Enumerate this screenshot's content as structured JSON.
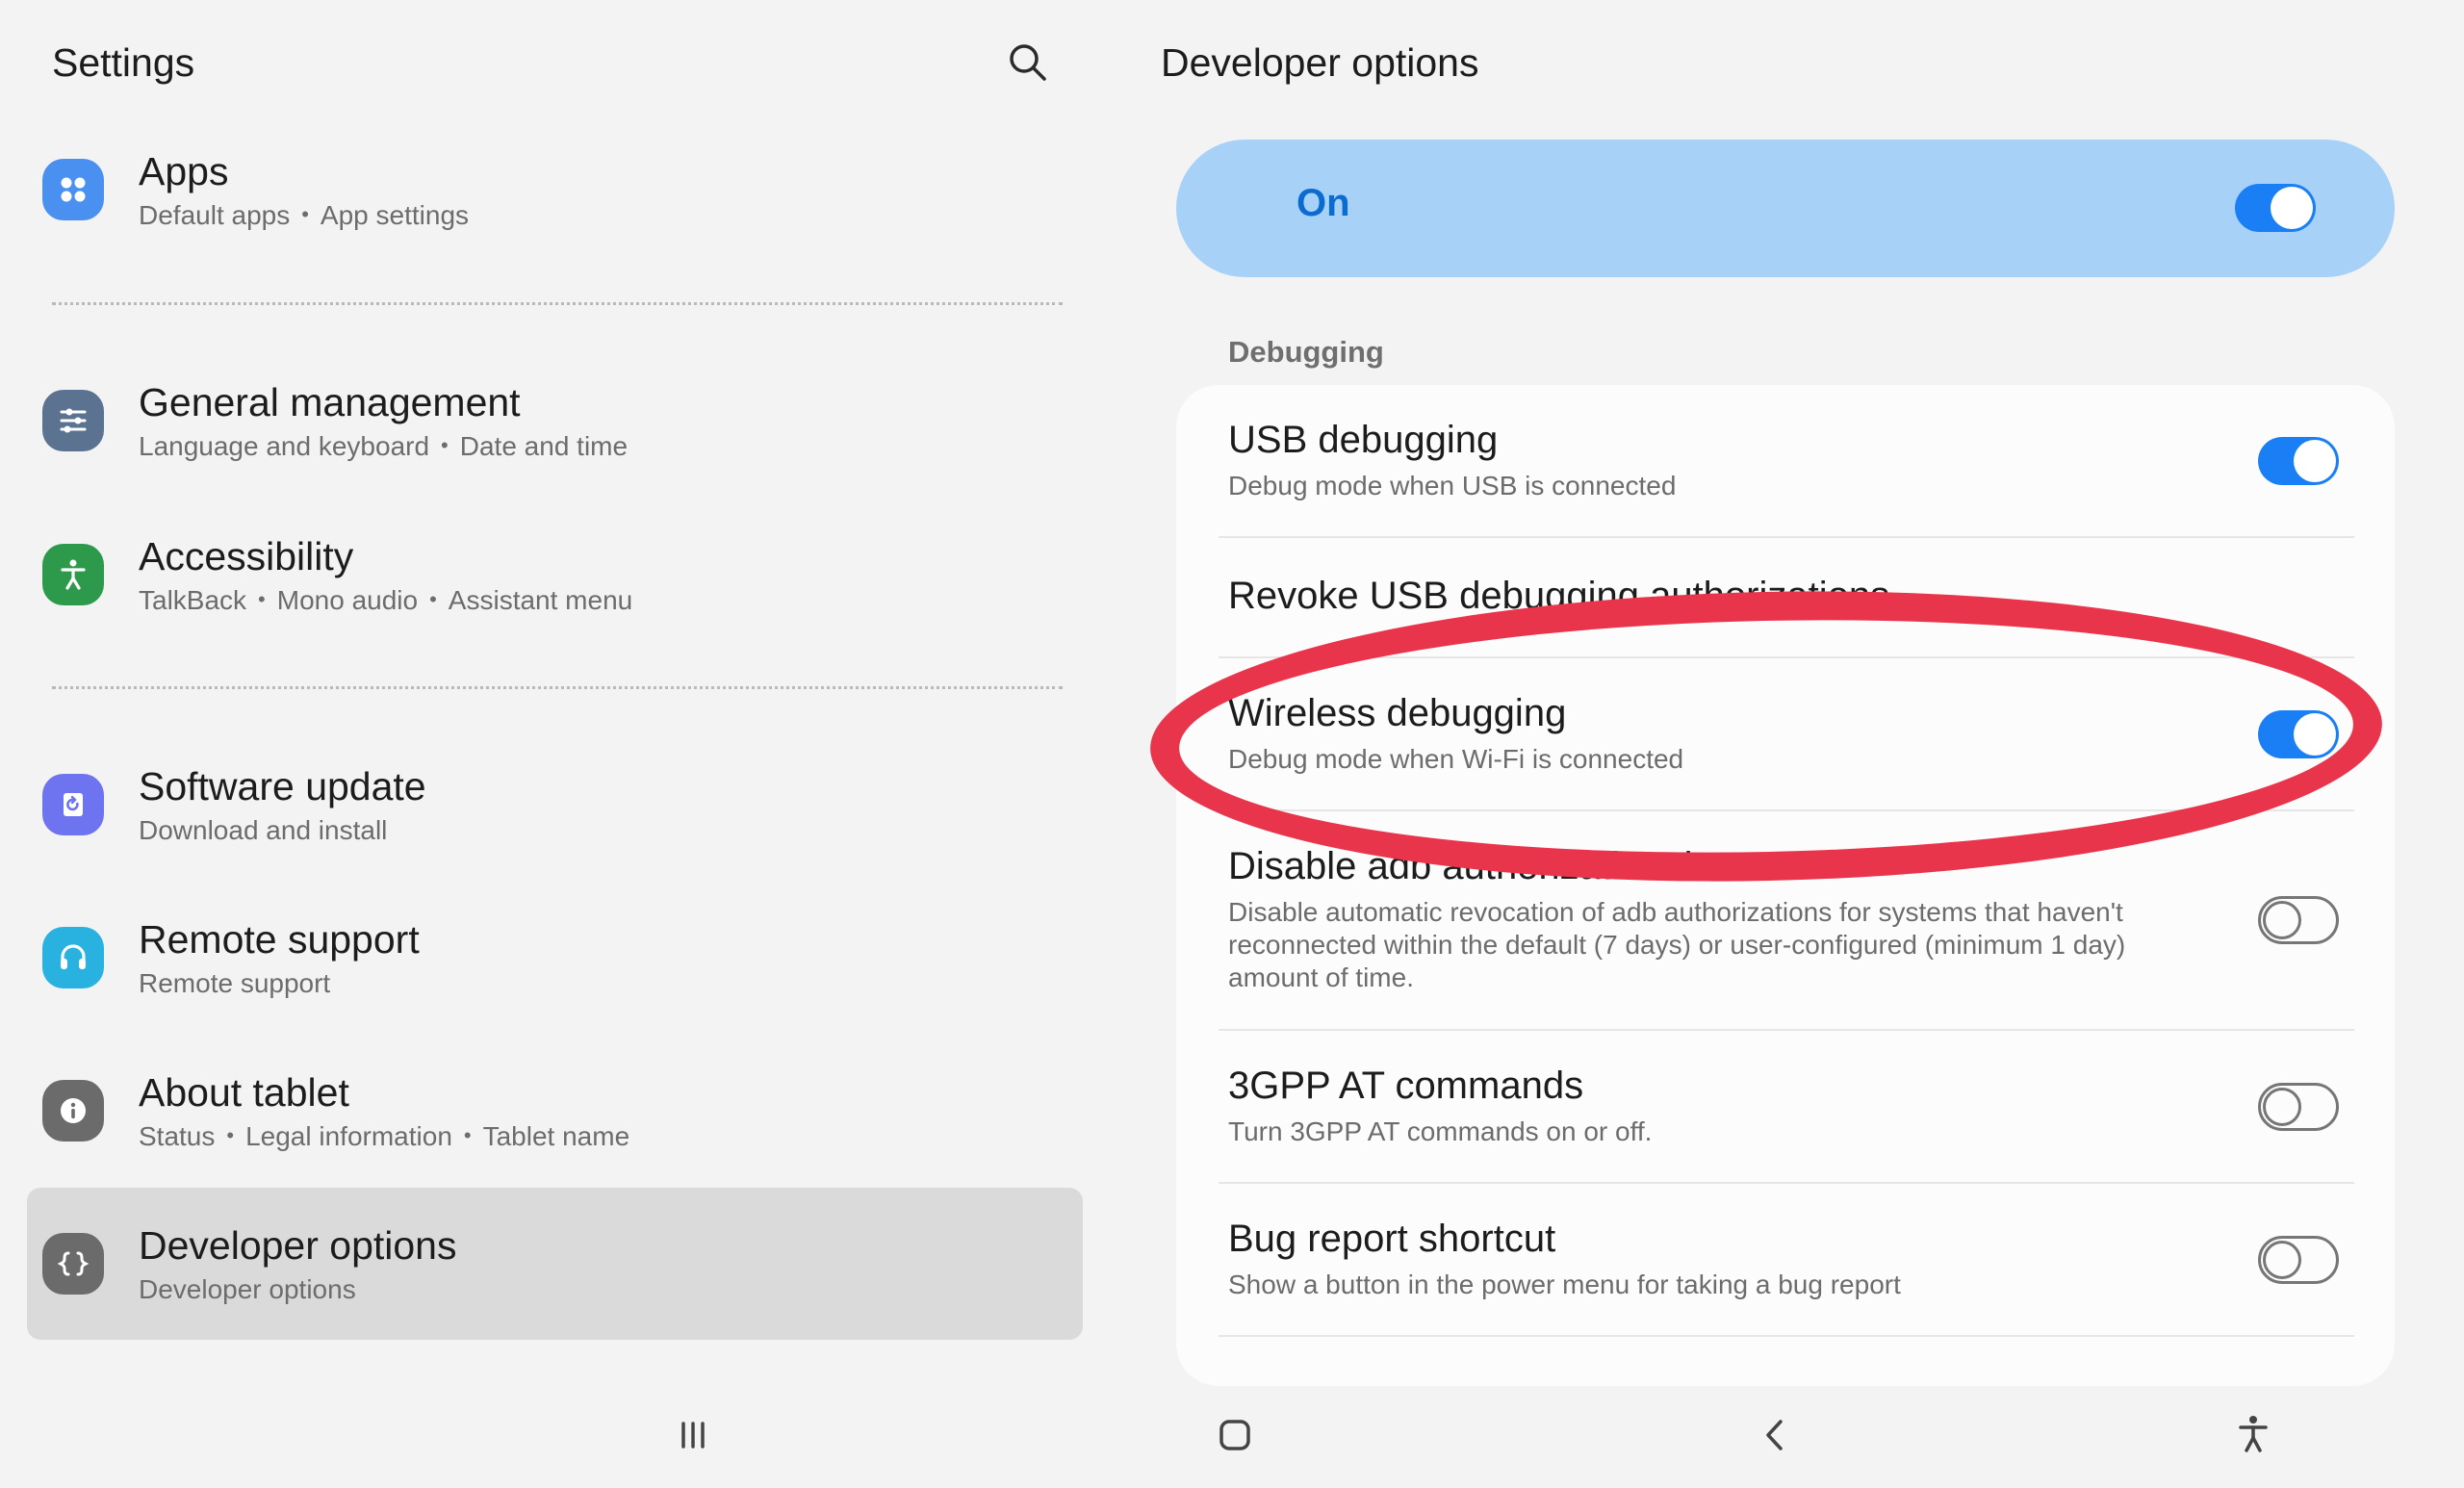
{
  "left": {
    "title": "Settings",
    "items": [
      {
        "title": "Apps",
        "sub": [
          "Default apps",
          "App settings"
        ],
        "color": "#4a90f0",
        "icon": "apps-icon"
      },
      {
        "title": "General management",
        "sub": [
          "Language and keyboard",
          "Date and time"
        ],
        "color": "#5b7391",
        "icon": "sliders-icon"
      },
      {
        "title": "Accessibility",
        "sub": [
          "TalkBack",
          "Mono audio",
          "Assistant menu"
        ],
        "color": "#2d9a4b",
        "icon": "accessibility-icon"
      },
      {
        "title": "Software update",
        "sub": [
          "Download and install"
        ],
        "color": "#6e73f0",
        "icon": "software-update-icon"
      },
      {
        "title": "Remote support",
        "sub": [
          "Remote support"
        ],
        "color": "#29b2e0",
        "icon": "headset-icon"
      },
      {
        "title": "About tablet",
        "sub": [
          "Status",
          "Legal information",
          "Tablet name"
        ],
        "color": "#6b6b6b",
        "icon": "info-icon"
      },
      {
        "title": "Developer options",
        "sub": [
          "Developer options"
        ],
        "color": "#6b6b6b",
        "icon": "braces-icon"
      }
    ]
  },
  "right": {
    "title": "Developer options",
    "master_label": "On",
    "master_on": true,
    "section": "Debugging",
    "rows": [
      {
        "title": "USB debugging",
        "sub": "Debug mode when USB is connected",
        "toggle": "on"
      },
      {
        "title": "Revoke USB debugging authorizations",
        "sub": "",
        "toggle": "none"
      },
      {
        "title": "Wireless debugging",
        "sub": "Debug mode when Wi-Fi is connected",
        "toggle": "on"
      },
      {
        "title": "Disable adb authorization timeout",
        "sub": "Disable automatic revocation of adb authorizations for systems that haven't reconnected within the default (7 days) or user-configured (minimum 1 day) amount of time.",
        "toggle": "off"
      },
      {
        "title": "3GPP AT commands",
        "sub": "Turn 3GPP AT commands on or off.",
        "toggle": "off"
      },
      {
        "title": "Bug report shortcut",
        "sub": "Show a button in the power menu for taking a bug report",
        "toggle": "off"
      }
    ]
  },
  "accent": "#1a7ff5",
  "highlight_color": "#e9354c",
  "nav": [
    "recent-apps-icon",
    "home-icon",
    "back-icon",
    "accessibility-shortcut-icon"
  ]
}
